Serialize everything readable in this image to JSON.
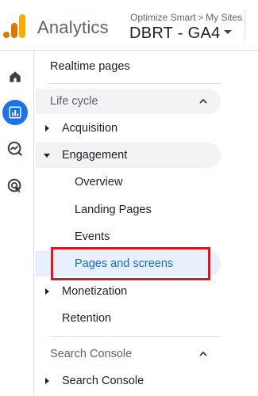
{
  "header": {
    "app_title": "Analytics",
    "breadcrumb_account": "Optimize Smart",
    "breadcrumb_separator": ">",
    "breadcrumb_site": "My Sites",
    "property_name": "DBRT - GA4"
  },
  "rail": {
    "icons": [
      "home-icon",
      "reports-icon",
      "explore-icon",
      "advertising-icon"
    ],
    "active_icon": "reports-icon"
  },
  "nav": {
    "realtime": "Realtime pages",
    "lifecycle_title": "Life cycle",
    "acquisition": "Acquisition",
    "engagement": "Engagement",
    "overview": "Overview",
    "landing_pages": "Landing Pages",
    "events": "Events",
    "pages_and_screens": "Pages and screens",
    "monetization": "Monetization",
    "retention": "Retention",
    "search_console_title": "Search Console",
    "search_console": "Search Console"
  },
  "colors": {
    "accent": "#1a73e8",
    "selected_bg": "#e8f0fe",
    "selected_text": "#1967d2",
    "section_bg": "#f1f3f4",
    "highlight": "#e3141b",
    "logo_orange": "#f9ab00",
    "logo_dark_orange": "#e37400"
  }
}
